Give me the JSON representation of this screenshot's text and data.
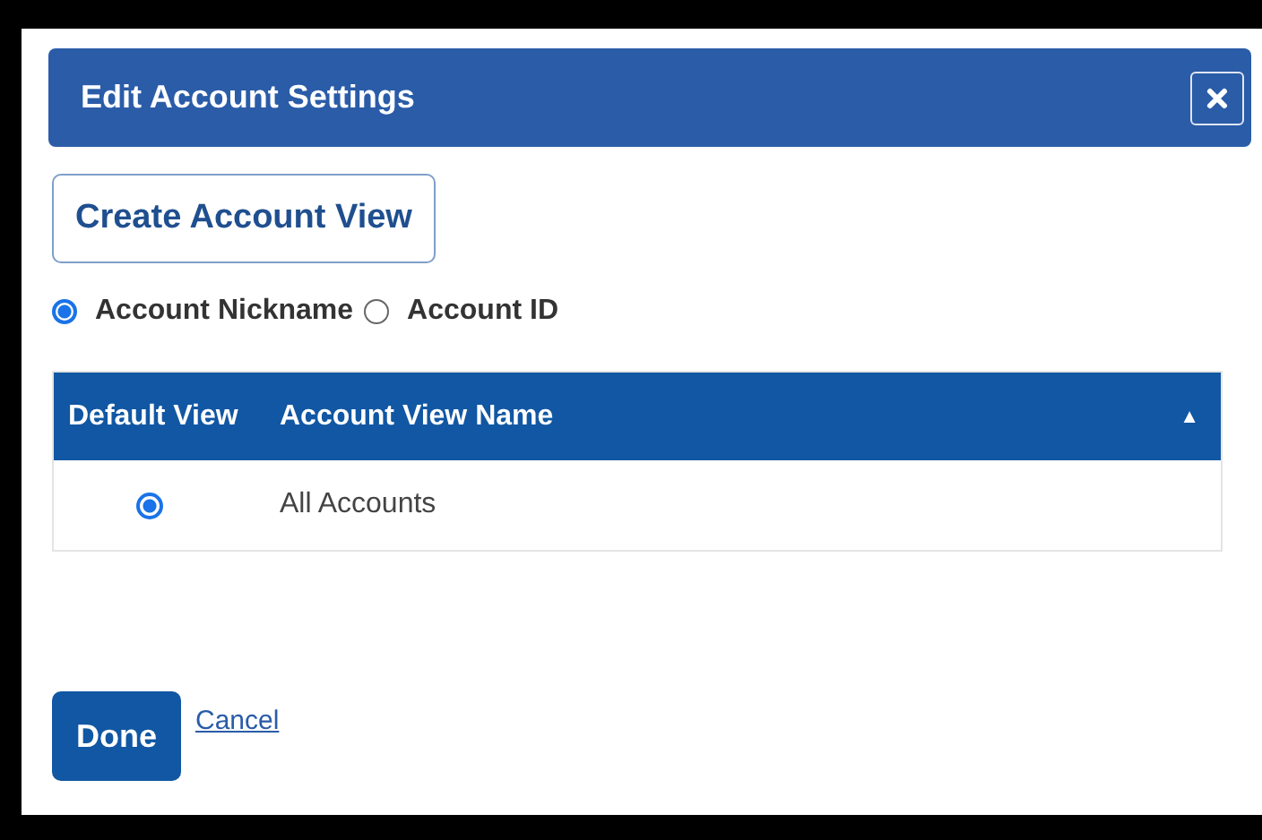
{
  "dialog": {
    "title": "Edit Account Settings"
  },
  "create_button": {
    "label": "Create Account View"
  },
  "display_options": [
    {
      "label": "Account Nickname",
      "selected": true
    },
    {
      "label": "Account ID",
      "selected": false
    }
  ],
  "table": {
    "columns": [
      "Default View",
      "Account View Name"
    ],
    "sort_indicator": "▲",
    "rows": [
      {
        "selected": true,
        "name": "All Accounts"
      }
    ]
  },
  "buttons": {
    "done": "Done",
    "cancel": "Cancel"
  }
}
